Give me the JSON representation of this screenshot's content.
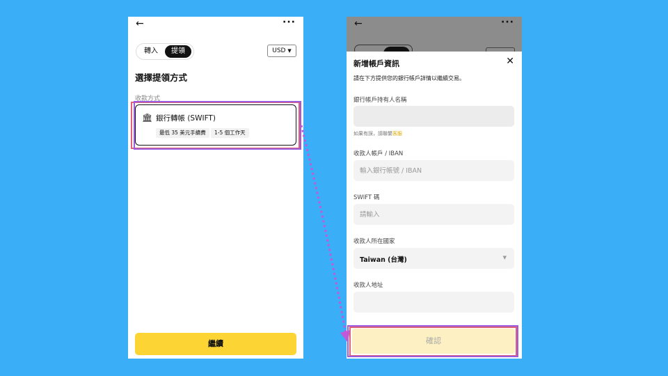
{
  "left": {
    "back_icon": "arrow-left-icon",
    "more_icon": "more-icon",
    "tabs": [
      {
        "label": "轉入"
      },
      {
        "label": "提領"
      }
    ],
    "currency": "USD",
    "title": "選擇提領方式",
    "section_label": "收款方式",
    "method": {
      "name": "銀行轉帳 (SWIFT)",
      "fee": "最低 35 美元手續費",
      "time": "1-5 個工作天"
    },
    "continue_label": "繼續"
  },
  "right": {
    "title": "新增帳戶資訊",
    "description": "請在下方提供您的銀行帳戶詳情以繼續交易。",
    "fields": {
      "holder_label": "銀行帳戶持有人名稱",
      "holder_hint_prefix": "如果有誤，請聯繫",
      "holder_hint_link": "客服",
      "iban_label": "收款人帳戶 / IBAN",
      "iban_placeholder": "輸入銀行帳號 / IBAN",
      "swift_label": "SWIFT 碼",
      "swift_placeholder": "請輸入",
      "country_label": "收款人所在國家",
      "country_value": "Taiwan (台灣)",
      "address_label": "收款人地址"
    },
    "confirm_label": "確認"
  },
  "colors": {
    "background": "#3aaef7",
    "accent": "#fcd535",
    "highlight_red": "#e06076",
    "highlight_purple": "#9a5de0"
  }
}
